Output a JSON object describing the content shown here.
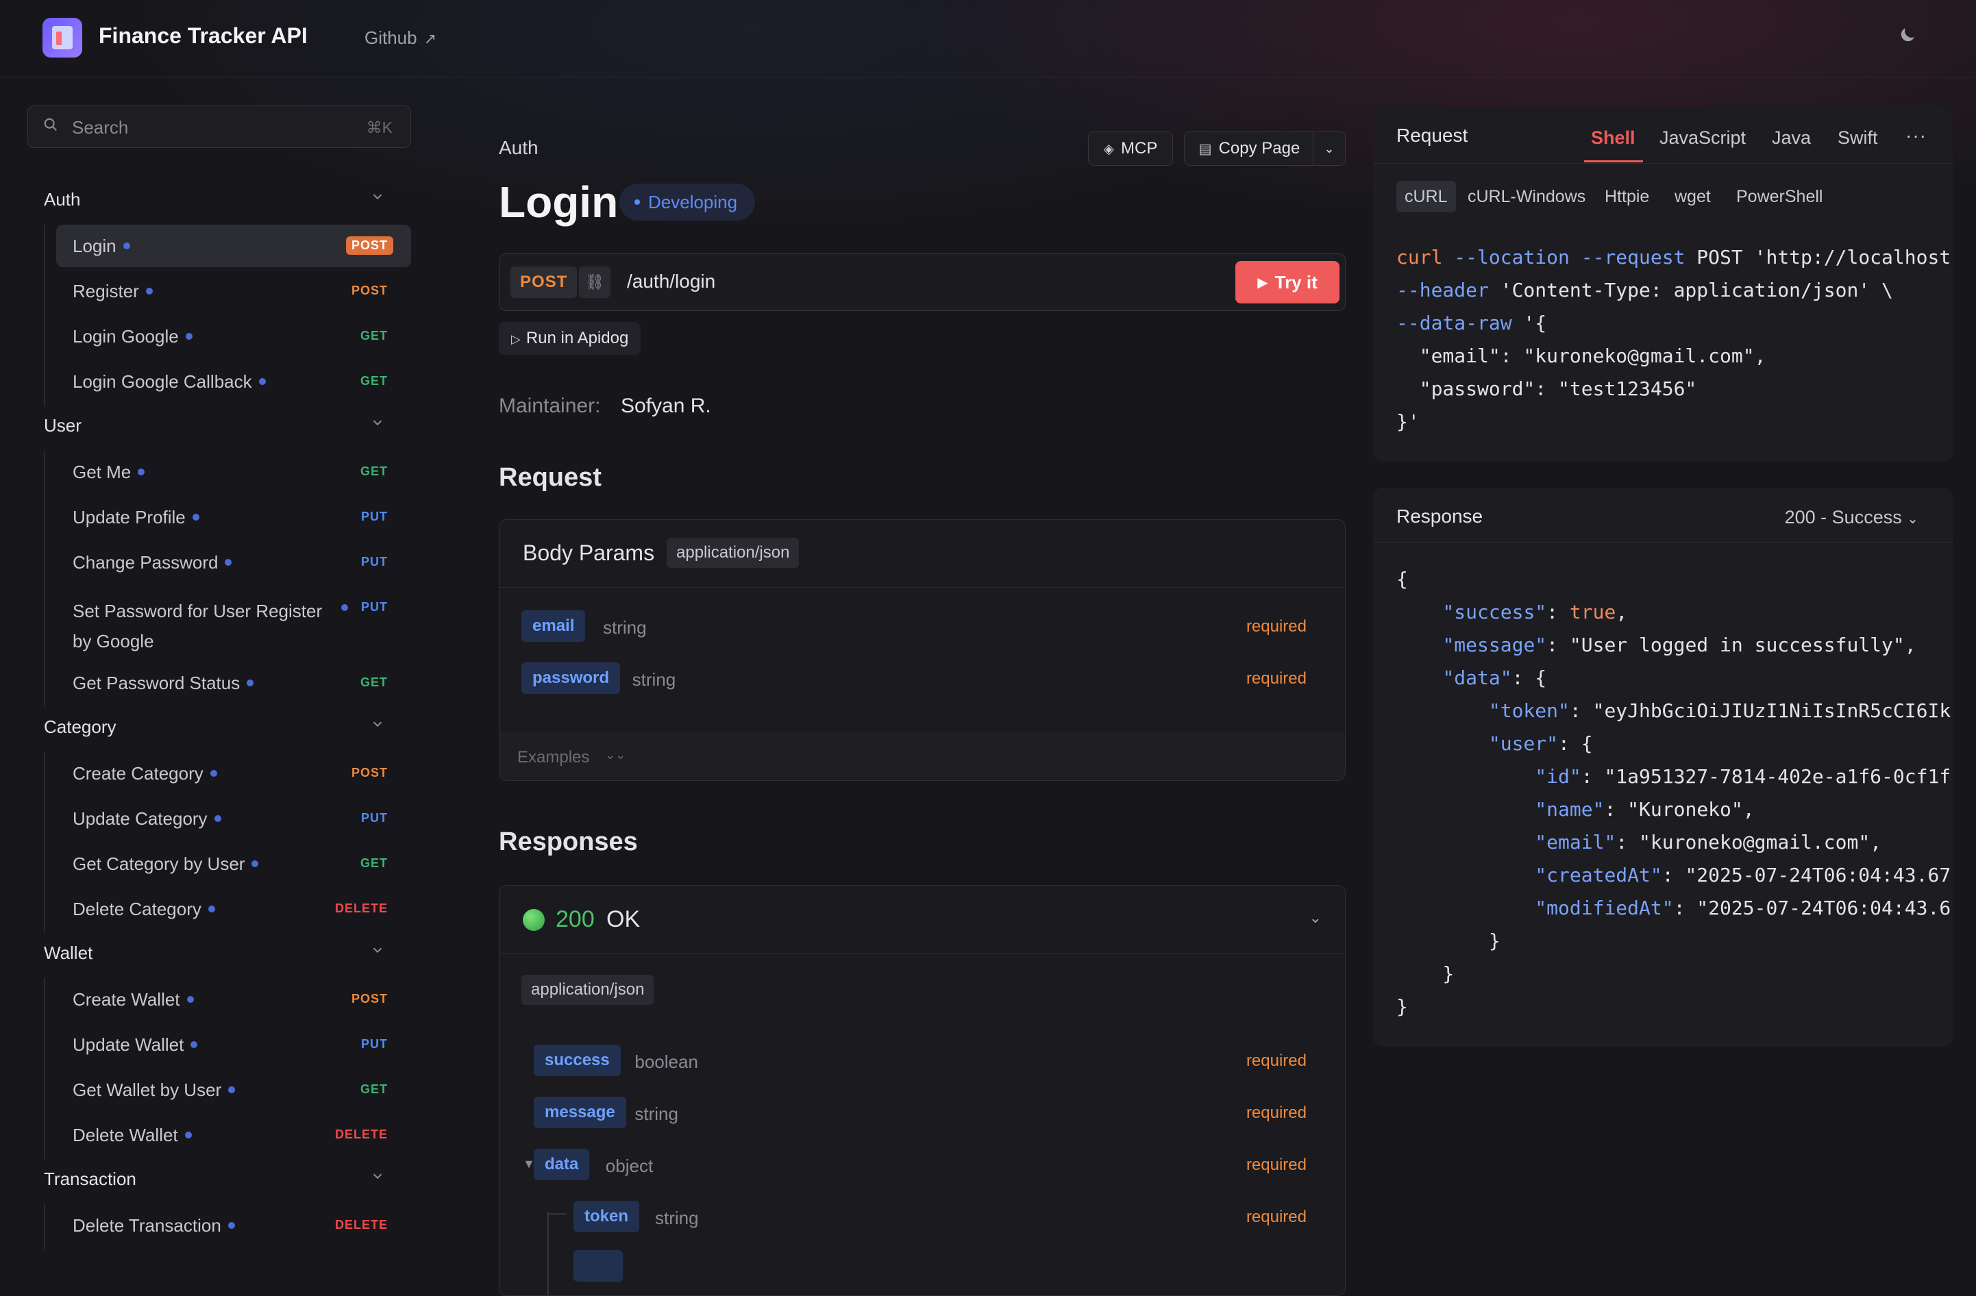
{
  "header": {
    "app_title": "Finance Tracker API",
    "github_label": "Github",
    "github_arrow": "↗",
    "theme_icon": "moon-icon"
  },
  "search": {
    "placeholder": "Search",
    "shortcut": "⌘K"
  },
  "sidebar": {
    "groups": [
      {
        "name": "Auth",
        "items": [
          {
            "label": "Login",
            "method": "POST",
            "active": true
          },
          {
            "label": "Register",
            "method": "POST"
          },
          {
            "label": "Login Google",
            "method": "GET"
          },
          {
            "label": "Login Google Callback",
            "method": "GET"
          }
        ]
      },
      {
        "name": "User",
        "items": [
          {
            "label": "Get Me",
            "method": "GET"
          },
          {
            "label": "Update Profile",
            "method": "PUT"
          },
          {
            "label": "Change Password",
            "method": "PUT"
          },
          {
            "label": "Set Password for User Register by Google",
            "method": "PUT"
          },
          {
            "label": "Get Password Status",
            "method": "GET"
          }
        ]
      },
      {
        "name": "Category",
        "items": [
          {
            "label": "Create Category",
            "method": "POST"
          },
          {
            "label": "Update Category",
            "method": "PUT"
          },
          {
            "label": "Get Category by User",
            "method": "GET"
          },
          {
            "label": "Delete Category",
            "method": "DELETE"
          }
        ]
      },
      {
        "name": "Wallet",
        "items": [
          {
            "label": "Create Wallet",
            "method": "POST"
          },
          {
            "label": "Update Wallet",
            "method": "PUT"
          },
          {
            "label": "Get Wallet by User",
            "method": "GET"
          },
          {
            "label": "Delete Wallet",
            "method": "DELETE"
          }
        ]
      },
      {
        "name": "Transaction",
        "items": [
          {
            "label": "Delete Transaction",
            "method": "DELETE"
          }
        ]
      }
    ]
  },
  "main": {
    "breadcrumb": "Auth",
    "mcp_label": "MCP",
    "copy_label": "Copy Page",
    "title": "Login",
    "status": "Developing",
    "method": "POST",
    "path": "/auth/login",
    "try_label": "Try it",
    "run_label": "Run in Apidog",
    "maintainer_label": "Maintainer:",
    "maintainer_name": "Sofyan R.",
    "request_heading": "Request",
    "body_params_title": "Body Params",
    "body_content_type": "application/json",
    "body_fields": [
      {
        "name": "email",
        "type": "string",
        "req": "required"
      },
      {
        "name": "password",
        "type": "string",
        "req": "required"
      }
    ],
    "examples_label": "Examples",
    "responses_heading": "Responses",
    "response_code": "200",
    "response_text": "OK",
    "response_content_type": "application/json",
    "response_fields": [
      {
        "name": "success",
        "type": "boolean",
        "req": "required"
      },
      {
        "name": "message",
        "type": "string",
        "req": "required"
      },
      {
        "name": "data",
        "type": "object",
        "req": "required"
      },
      {
        "name": "token",
        "type": "string",
        "req": "required"
      }
    ]
  },
  "request_panel": {
    "title": "Request",
    "tabs": [
      "Shell",
      "JavaScript",
      "Java",
      "Swift"
    ],
    "active_tab": "Shell",
    "more": "···",
    "sub_tabs": [
      "cURL",
      "cURL-Windows",
      "Httpie",
      "wget",
      "PowerShell"
    ],
    "active_sub_tab": "cURL",
    "code_lines": [
      "curl --location --request POST 'http://localhost",
      "--header 'Content-Type: application/json' \\",
      "--data-raw '{",
      "  \"email\": \"kuroneko@gmail.com\",",
      "  \"password\": \"test123456\"",
      "}'"
    ]
  },
  "response_panel": {
    "title": "Response",
    "status_select": "200 - Success",
    "json_lines": [
      "{",
      "    \"success\": true,",
      "    \"message\": \"User logged in successfully\",",
      "    \"data\": {",
      "        \"token\": \"eyJhbGciOiJIUzI1NiIsInR5cCI6Ik",
      "        \"user\": {",
      "            \"id\": \"1a951327-7814-402e-a1f6-0cf1f",
      "            \"name\": \"Kuroneko\",",
      "            \"email\": \"kuroneko@gmail.com\",",
      "            \"createdAt\": \"2025-07-24T06:04:43.67",
      "            \"modifiedAt\": \"2025-07-24T06:04:43.6",
      "        }",
      "    }",
      "}"
    ]
  },
  "colors": {
    "accent": "#ef5a5a",
    "post": "#f08a3c",
    "get": "#3cb371",
    "put": "#4d8cf5",
    "delete": "#ef4a4a"
  }
}
